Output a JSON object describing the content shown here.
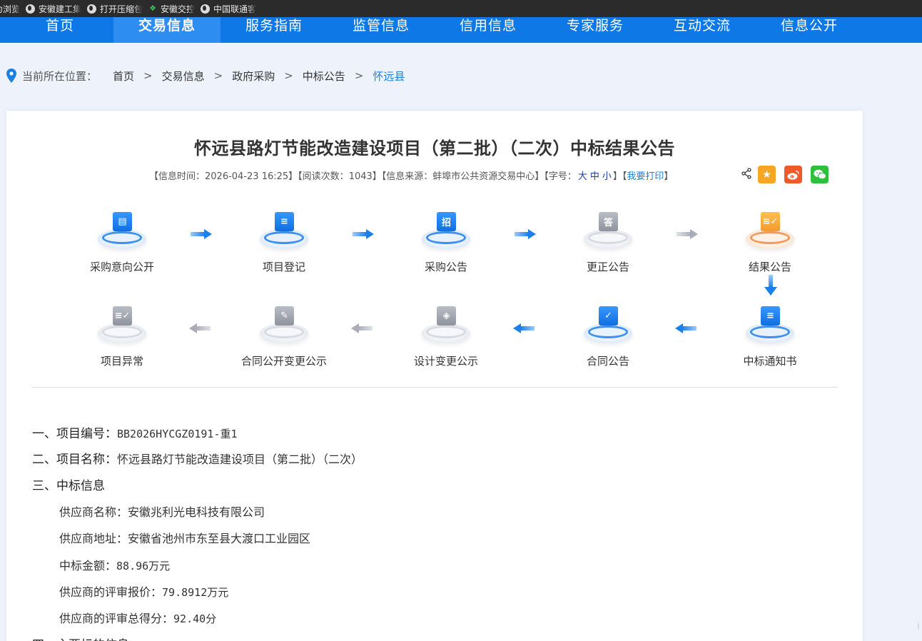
{
  "bookmarks": [
    {
      "label": "为浏览",
      "icon": "globe-icon"
    },
    {
      "label": "安徽建工集团",
      "icon": "globe-icon"
    },
    {
      "label": "打开压缩包",
      "icon": "globe-icon"
    },
    {
      "label": "安徽交控",
      "icon": "leaf-icon"
    },
    {
      "label": "中国联通客服",
      "icon": "globe-icon"
    }
  ],
  "nav": [
    "首页",
    "交易信息",
    "服务指南",
    "监管信息",
    "信用信息",
    "专家服务",
    "互动交流",
    "信息公开"
  ],
  "nav_active": "交易信息",
  "breadcrumb": {
    "label": "当前所在位置：",
    "items": [
      "首页",
      "交易信息",
      "政府采购",
      "中标公告",
      "怀远县"
    ],
    "sep": ">"
  },
  "article": {
    "title": "怀远县路灯节能改造建设项目（第二批）（二次）中标结果公告",
    "meta_time_label": "【信息时间：",
    "meta_time": "2026-04-23 16:25",
    "meta_reads_label": "】【阅读次数：",
    "meta_reads": "1043",
    "meta_source_label": "】【信息来源：",
    "meta_source": "蚌埠市公共资源交易中心",
    "meta_font_label": "】【字号：",
    "font_sizes": [
      "大",
      "中",
      "小"
    ],
    "meta_print_open": "】【",
    "print_label": "我要打印",
    "meta_close": "】"
  },
  "share": {
    "share_icon": "share-icon",
    "star_icon": "star-icon",
    "weibo_icon": "weibo-icon",
    "wechat_icon": "wechat-icon"
  },
  "process": {
    "top": [
      {
        "label": "采购意向公开",
        "icon": "intent-doc-icon",
        "glyph": "▤",
        "state": "active"
      },
      {
        "label": "项目登记",
        "icon": "register-icon",
        "glyph": "≡",
        "state": "active"
      },
      {
        "label": "采购公告",
        "icon": "bid-notice-icon",
        "glyph": "招",
        "state": "active"
      },
      {
        "label": "更正公告",
        "icon": "correction-icon",
        "glyph": "答",
        "state": "inactive"
      },
      {
        "label": "结果公告",
        "icon": "result-icon",
        "glyph": "≡✓",
        "state": "current"
      }
    ],
    "bottom": [
      {
        "label": "项目异常",
        "icon": "exception-icon",
        "glyph": "≡✓",
        "state": "inactive"
      },
      {
        "label": "合同公开变更公示",
        "icon": "contract-change-icon",
        "glyph": "✎",
        "state": "inactive"
      },
      {
        "label": "设计变更公示",
        "icon": "design-change-icon",
        "glyph": "◈",
        "state": "inactive"
      },
      {
        "label": "合同公告",
        "icon": "contract-icon",
        "glyph": "✓",
        "state": "active"
      },
      {
        "label": "中标通知书",
        "icon": "award-notice-icon",
        "glyph": "≡",
        "state": "active"
      }
    ]
  },
  "content": {
    "item1_label": "一、项目编号：",
    "item1_value": "BB2026HYCGZ0191-重1",
    "item2_label": "二、项目名称：",
    "item2_value": "怀远县路灯节能改造建设项目（第二批）（二次）",
    "item3_label": "三、中标信息",
    "supplier_name": "供应商名称：安徽兆利光电科技有限公司",
    "supplier_addr": "供应商地址：安徽省池州市东至县大渡口工业园区",
    "amount_label": "中标金额：",
    "amount_value": "88.96万元",
    "price_label": "供应商的评审报价：",
    "price_value": "79.8912万元",
    "score_label": "供应商的评审总得分：",
    "score_value": "92.40分",
    "item4_label": "四、主要标的信息"
  },
  "colors": {
    "nav_bg": "#0d78e6",
    "nav_active": "#2e8df0",
    "link": "#1d7fe0",
    "star": "#f5a623",
    "weibo": "#f05a28",
    "wechat": "#2fbf3f"
  }
}
